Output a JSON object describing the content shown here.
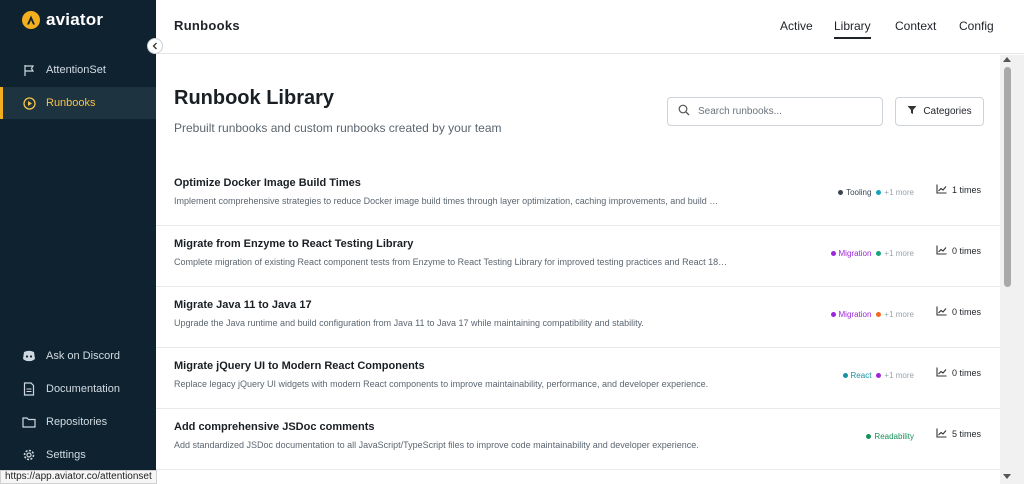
{
  "brand": {
    "name": "aviator"
  },
  "sidebar": {
    "items": [
      {
        "label": "AttentionSet",
        "icon": "flag-icon"
      },
      {
        "label": "Runbooks",
        "icon": "play-circle-icon",
        "active": true
      },
      {
        "label": "Ask on Discord",
        "icon": "discord-icon"
      },
      {
        "label": "Documentation",
        "icon": "document-icon"
      },
      {
        "label": "Repositories",
        "icon": "folder-icon"
      },
      {
        "label": "Settings",
        "icon": "gear-icon"
      }
    ]
  },
  "status_url": "https://app.aviator.co/attentionset",
  "header": {
    "title": "Runbooks",
    "tabs": [
      {
        "label": "Active"
      },
      {
        "label": "Library",
        "active": true
      },
      {
        "label": "Context"
      },
      {
        "label": "Config"
      }
    ]
  },
  "main": {
    "title": "Runbook Library",
    "subtitle": "Prebuilt runbooks and custom runbooks created by your team",
    "search_placeholder": "Search runbooks...",
    "categories_label": "Categories"
  },
  "runbooks": [
    {
      "title": "Optimize Docker Image Build Times",
      "description": "Implement comprehensive strategies to reduce Docker image build times through layer optimization, caching improvements, and build …",
      "tag": "Tooling",
      "tag_color": "#3d4650",
      "more": "+1 more",
      "more_color": "#17a2b8",
      "usage": "1 times"
    },
    {
      "title": "Migrate from Enzyme to React Testing Library",
      "description": "Complete migration of existing React component tests from Enzyme to React Testing Library for improved testing practices and React 18…",
      "tag": "Migration",
      "tag_color": "#9b27d9",
      "more": "+1 more",
      "more_color": "#1aa37a",
      "usage": "0 times"
    },
    {
      "title": "Migrate Java 11 to Java 17",
      "description": "Upgrade the Java runtime and build configuration from Java 11 to Java 17 while maintaining compatibility and stability.",
      "tag": "Migration",
      "tag_color": "#9b27d9",
      "more": "+1 more",
      "more_color": "#f06a1d",
      "usage": "0 times"
    },
    {
      "title": "Migrate jQuery UI to Modern React Components",
      "description": "Replace legacy jQuery UI widgets with modern React components to improve maintainability, performance, and developer experience.",
      "tag": "React",
      "tag_color": "#1593a3",
      "more": "+1 more",
      "more_color": "#9b27d9",
      "usage": "0 times"
    },
    {
      "title": "Add comprehensive JSDoc comments",
      "description": "Add standardized JSDoc documentation to all JavaScript/TypeScript files to improve code maintainability and developer experience.",
      "tag": "Readability",
      "tag_color": "#17915a",
      "more": "",
      "more_color": "",
      "usage": "5 times"
    }
  ]
}
